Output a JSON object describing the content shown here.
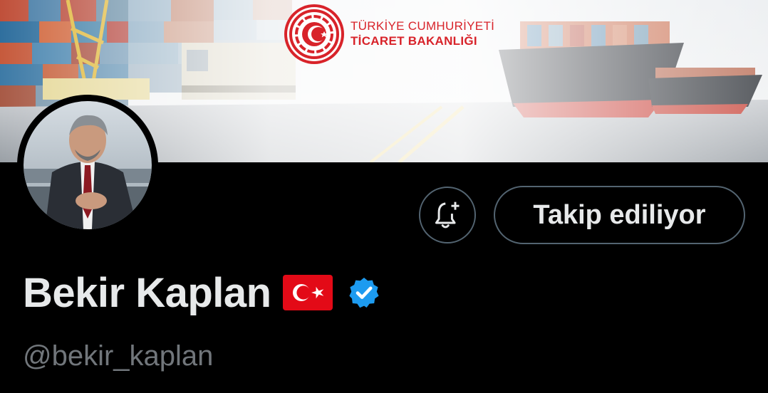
{
  "banner": {
    "ministry_name_line1": "TÜRKİYE CUMHURİYETİ",
    "ministry_name_line2": "TİCARET BAKANLIĞI",
    "brand_color": "#d8232a"
  },
  "profile": {
    "display_name": "Bekir Kaplan",
    "handle": "@bekir_kaplan",
    "flag_icon": "turkey-flag-icon",
    "verified_icon": "verified-badge-icon",
    "verified_color": "#1d9bf0"
  },
  "actions": {
    "notify_icon": "bell-plus-icon",
    "follow_label": "Takip ediliyor"
  },
  "colors": {
    "background": "#000000",
    "text_primary": "#e7e9ea",
    "text_secondary": "#71767b",
    "button_border": "#536471"
  }
}
